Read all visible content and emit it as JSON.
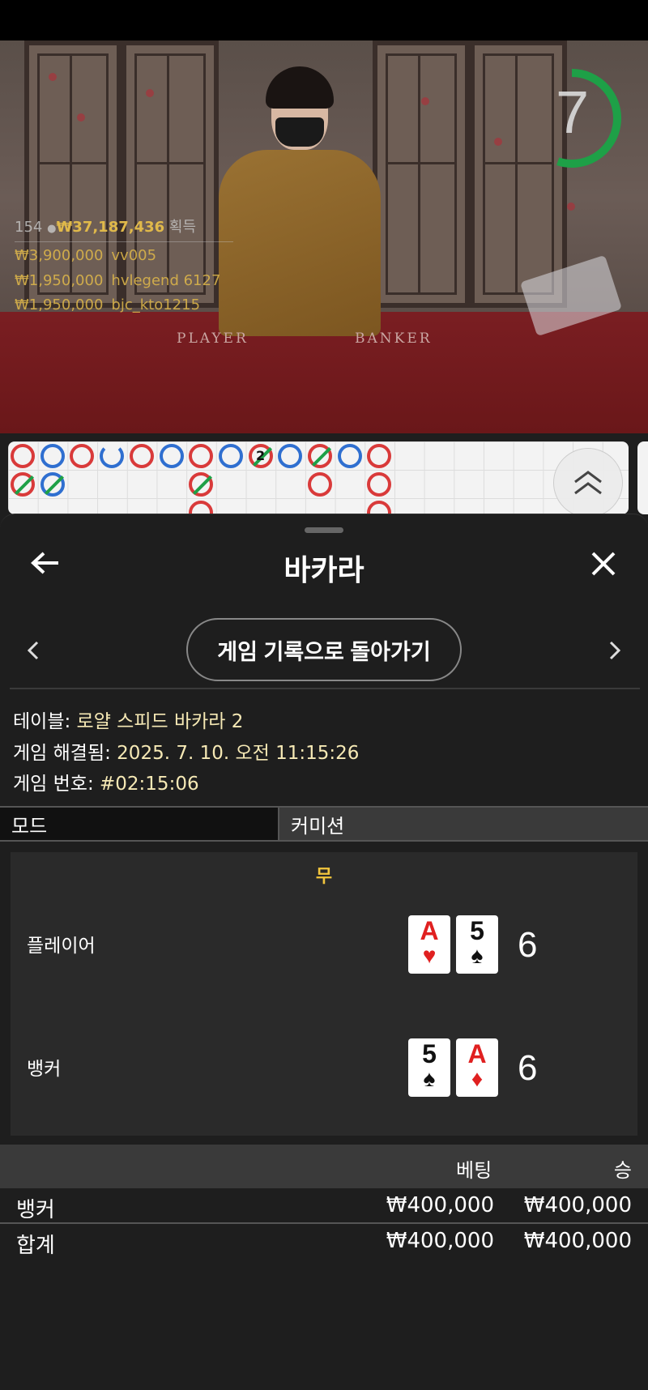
{
  "video": {
    "countdown": "7",
    "countdown_progress": 0.55,
    "table_labels": {
      "player": "PLAYER",
      "banker": "BANKER"
    },
    "stats": {
      "players": "154",
      "total": "₩37,187,436",
      "suffix": "획득"
    },
    "winners": [
      {
        "amount": "₩3,900,000",
        "name": "vv005"
      },
      {
        "amount": "₩1,950,000",
        "name": "hvlegend 6127"
      },
      {
        "amount": "₩1,950,000",
        "name": "bjc_kto1215"
      }
    ]
  },
  "roadmap": {
    "beads": [
      {
        "col": 0,
        "row": 0,
        "color": "red"
      },
      {
        "col": 1,
        "row": 0,
        "color": "blue"
      },
      {
        "col": 2,
        "row": 0,
        "color": "red"
      },
      {
        "col": 3,
        "row": 0,
        "color": "blue",
        "open": true
      },
      {
        "col": 4,
        "row": 0,
        "color": "red"
      },
      {
        "col": 5,
        "row": 0,
        "color": "blue"
      },
      {
        "col": 6,
        "row": 0,
        "color": "red"
      },
      {
        "col": 7,
        "row": 0,
        "color": "blue"
      },
      {
        "col": 8,
        "row": 0,
        "color": "red",
        "slash": true,
        "num": "2"
      },
      {
        "col": 9,
        "row": 0,
        "color": "blue"
      },
      {
        "col": 10,
        "row": 0,
        "color": "red",
        "slash": true
      },
      {
        "col": 11,
        "row": 0,
        "color": "blue"
      },
      {
        "col": 12,
        "row": 0,
        "color": "red"
      },
      {
        "col": 0,
        "row": 1,
        "color": "red",
        "slash": true
      },
      {
        "col": 1,
        "row": 1,
        "color": "blue",
        "slash": true
      },
      {
        "col": 6,
        "row": 1,
        "color": "red",
        "slash": true
      },
      {
        "col": 10,
        "row": 1,
        "color": "red"
      },
      {
        "col": 12,
        "row": 1,
        "color": "red"
      },
      {
        "col": 6,
        "row": 2,
        "color": "red"
      },
      {
        "col": 12,
        "row": 2,
        "color": "red"
      }
    ]
  },
  "sheet": {
    "title": "바카라",
    "history_button": "게임 기록으로 돌아가기",
    "table_label": "테이블: ",
    "table_value": "로얄 스피드 바카라 2",
    "resolved_label": "게임 해결됨: ",
    "resolved_value": "2025. 7. 10. 오전 11:15:26",
    "game_no_label": "게임 번호: ",
    "game_no_value": "#02:15:06",
    "mode_label": "모드",
    "commission_label": "커미션"
  },
  "result": {
    "outcome": "무",
    "player": {
      "label": "플레이어",
      "score": "6",
      "cards": [
        {
          "rank": "A",
          "suit": "♥",
          "color": "red"
        },
        {
          "rank": "5",
          "suit": "♠",
          "color": "black"
        }
      ]
    },
    "banker": {
      "label": "뱅커",
      "score": "6",
      "cards": [
        {
          "rank": "5",
          "suit": "♠",
          "color": "black"
        },
        {
          "rank": "A",
          "suit": "♦",
          "color": "red"
        }
      ]
    }
  },
  "bets": {
    "headers": {
      "bet": "베팅",
      "win": "승"
    },
    "rows": [
      {
        "label": "뱅커",
        "bet": "₩400,000",
        "win": "₩400,000"
      },
      {
        "label": "합계",
        "bet": "₩400,000",
        "win": "₩400,000"
      }
    ]
  },
  "colors": {
    "accent_yellow": "#f2c53d",
    "value_text": "#f6e9b5",
    "timer_green": "#1ea047"
  }
}
